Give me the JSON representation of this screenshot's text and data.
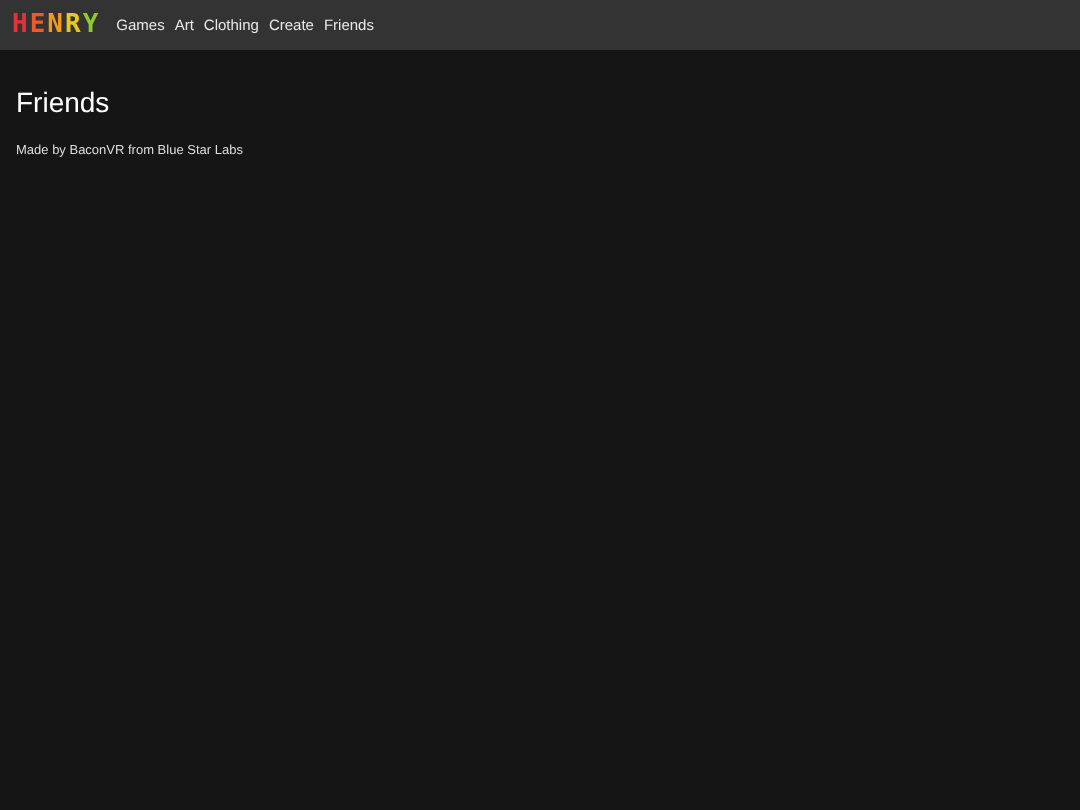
{
  "logo": [
    {
      "text": "H",
      "color": "#e8303a"
    },
    {
      "text": "E",
      "color": "#ef5a2a"
    },
    {
      "text": "N",
      "color": "#f09a20"
    },
    {
      "text": "R",
      "color": "#e8c820"
    },
    {
      "text": "Y",
      "color": "#8ccc2a"
    }
  ],
  "nav": [
    "Games",
    "Art",
    "Clothing",
    "Create",
    "Friends"
  ],
  "heading": "Friends",
  "credit": "Made by BaconVR from Blue Star Labs"
}
